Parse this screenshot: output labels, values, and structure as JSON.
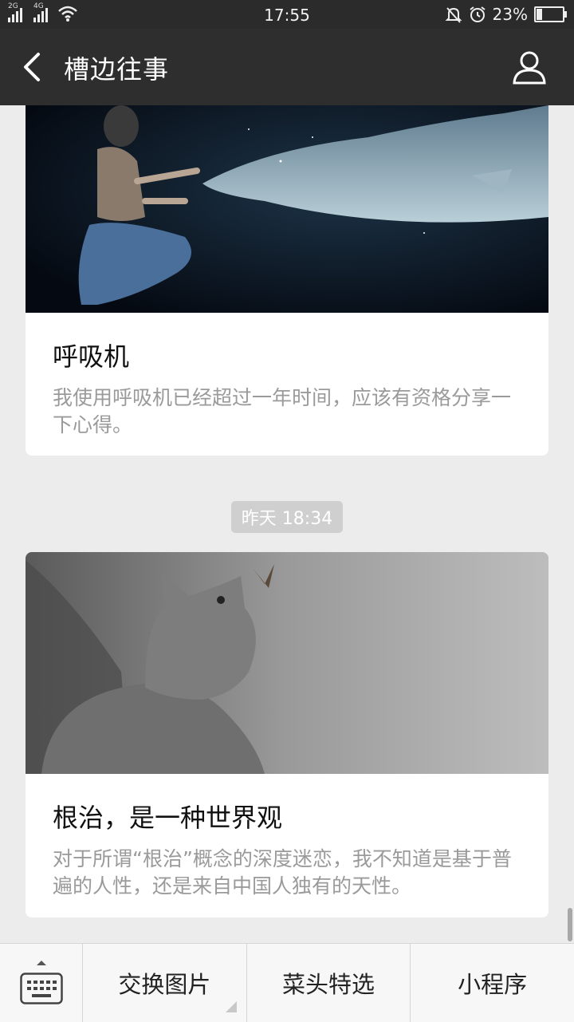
{
  "status_bar": {
    "sim1": "2G",
    "sim2": "4G",
    "time": "17:55",
    "battery": "23%",
    "battery_level": 0.23
  },
  "header": {
    "title": "槽边往事"
  },
  "feed": {
    "items": [
      {
        "title": "呼吸机",
        "description": "我使用呼吸机已经超过一年时间，应该有资格分享一下心得。"
      },
      {
        "title": "根治，是一种世界观",
        "description": "对于所谓“根治”概念的深度迷恋，我不知道是基于普遍的人性，还是来自中国人独有的天性。"
      }
    ],
    "timestamp": "昨天 18:34"
  },
  "bottom_menu": {
    "items": [
      "交换图片",
      "菜头特选",
      "小程序"
    ]
  },
  "colors": {
    "bar": "#2e2e2e",
    "background": "#ececec"
  }
}
